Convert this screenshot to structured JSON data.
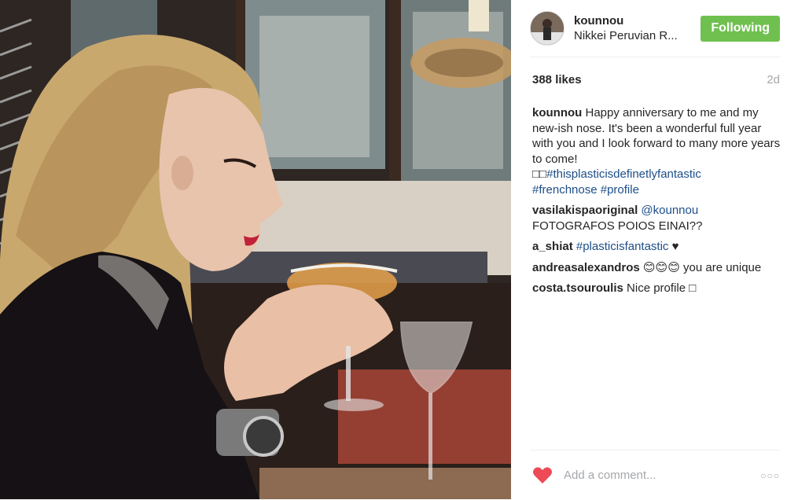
{
  "post": {
    "author": {
      "username": "kounnou",
      "location": "Nikkei Peruvian R..."
    },
    "follow_button_label": "Following",
    "likes_text": "388 likes",
    "time_ago": "2d",
    "caption": {
      "username": "kounnou",
      "text": "Happy anniversary to me and my new-ish nose. It's been a wonderful full year with you and I look forward to many more years to come!",
      "prefix_glyphs": "□□",
      "hashtags": [
        "#thisplasticisdefinetlyfantastic",
        "#frenchnose",
        "#profile"
      ]
    },
    "comments": [
      {
        "username": "vasilakispaoriginal",
        "mention": "@kounnou",
        "text": "FOTOGRAFOS POIOS EINAI??"
      },
      {
        "username": "a_shiat",
        "hashtag": "#plasticisfantastic",
        "text": "♥"
      },
      {
        "username": "andreasalexandros",
        "text": "😊😊😊 you are unique"
      },
      {
        "username": "costa.tsouroulis",
        "text": "Nice profile □"
      }
    ],
    "comment_placeholder": "Add a comment...",
    "more_options_label": "○○○"
  },
  "colors": {
    "follow_green": "#70c050",
    "hashtag_blue": "#1d4e89",
    "like_red": "#ed4956",
    "muted_gray": "#a5a7aa"
  },
  "icons": {
    "like": "heart-icon",
    "options": "more-options-icon"
  }
}
